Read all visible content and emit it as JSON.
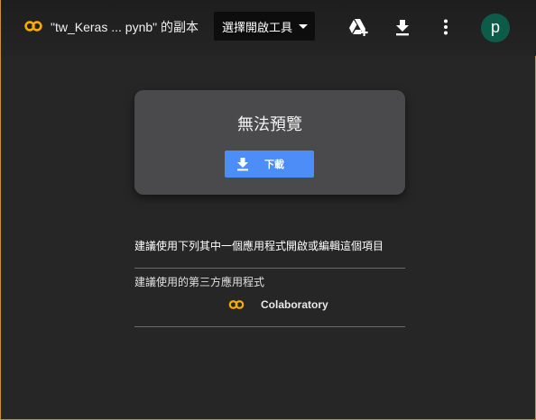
{
  "header": {
    "file_title": "\"tw_Keras ... pynb\" 的副本",
    "open_with_label": "選擇開啟工具",
    "avatar_letter": "p",
    "icons": [
      "colab-logo-icon",
      "add-to-drive-icon",
      "download-icon",
      "more-vert-icon"
    ]
  },
  "preview": {
    "message": "無法預覽",
    "download_label": "下載"
  },
  "suggestions": {
    "text": "建議使用下列其中一個應用程式開啟或編輯這個項目",
    "third_party_label": "建議使用的第三方應用程式",
    "apps": [
      {
        "name": "Colaboratory",
        "icon": "colab-logo-icon"
      }
    ]
  },
  "colors": {
    "background": "#262626",
    "card": "#4a494b",
    "accent_blue": "#4d8df7",
    "colab_orange": "#f9ab00",
    "avatar": "#0d5c4a"
  }
}
